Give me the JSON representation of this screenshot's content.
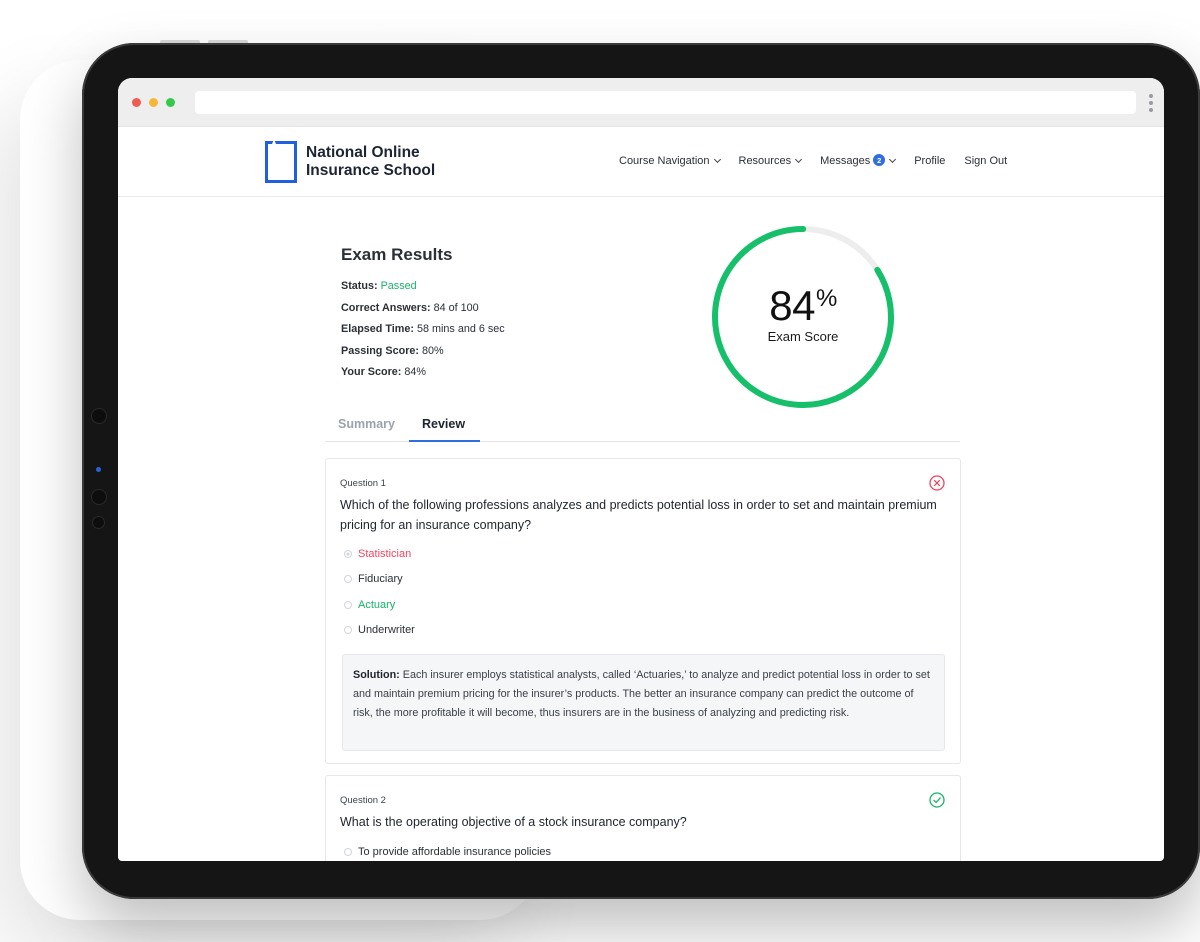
{
  "site": {
    "logo_line1": "National Online",
    "logo_line2": "Insurance School"
  },
  "nav": {
    "course_navigation": "Course Navigation",
    "resources": "Resources",
    "messages": "Messages",
    "messages_badge": "2",
    "profile": "Profile",
    "sign_out": "Sign Out"
  },
  "results": {
    "title": "Exam Results",
    "status_label": "Status:",
    "status_value": "Passed",
    "correct_label": "Correct Answers:",
    "correct_value": "84 of 100",
    "elapsed_label": "Elapsed Time:",
    "elapsed_value": "58 mins and 6 sec",
    "passing_label": "Passing Score:",
    "passing_value": "80%",
    "score_label": "Your Score:",
    "score_value": "84%"
  },
  "gauge": {
    "value": "84",
    "unit": "%",
    "label": "Exam Score",
    "fraction": 0.84,
    "track_color": "#ededed",
    "fill_color": "#16c06a"
  },
  "tabs": {
    "summary": "Summary",
    "review": "Review",
    "active": "Review"
  },
  "questions": [
    {
      "number_label": "Question 1",
      "text": "Which of the following professions analyzes and predicts potential loss in order to set and maintain premium pricing for an insurance company?",
      "result": "incorrect",
      "options": [
        {
          "label": "Statistician",
          "state": "selected-wrong"
        },
        {
          "label": "Fiduciary",
          "state": "neutral"
        },
        {
          "label": "Actuary",
          "state": "correct"
        },
        {
          "label": "Underwriter",
          "state": "neutral"
        }
      ],
      "solution_label": "Solution:",
      "solution_text": "Each insurer employs statistical analysts, called ‘Actuaries,’ to analyze and predict potential loss in order to set and maintain premium pricing for the insurer’s products. The better an insurance company can predict the outcome of risk, the more profitable it will become, thus insurers are in the business of analyzing and predicting risk."
    },
    {
      "number_label": "Question 2",
      "text": "What is the operating objective of a stock insurance company?",
      "result": "correct",
      "options": [
        {
          "label": "To provide affordable insurance policies",
          "state": "neutral"
        }
      ]
    }
  ],
  "colors": {
    "brand_blue": "#2f6de1",
    "pass_green": "#17b26a",
    "error_red": "#ef4461"
  }
}
